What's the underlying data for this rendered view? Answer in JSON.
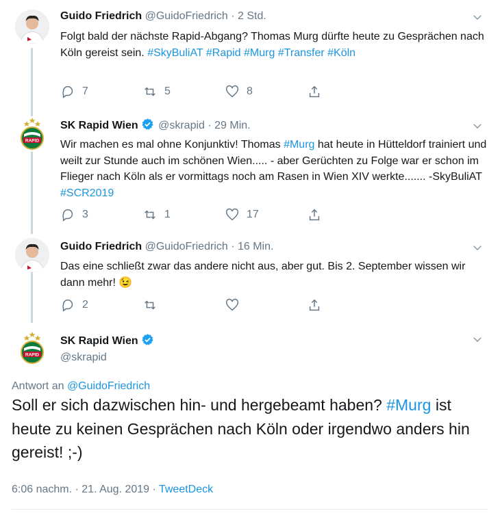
{
  "tweets": [
    {
      "name": "Guido Friedrich",
      "handle": "@GuidoFriedrich",
      "time": "· 2 Std.",
      "text_parts": [
        {
          "t": "Folgt bald der nächste Rapid-Abgang? Thomas Murg dürfte heute zu Gesprächen nach Köln gereist sein. "
        },
        {
          "t": "#SkyBuliAT",
          "tag": true
        },
        {
          "t": " "
        },
        {
          "t": "#Rapid",
          "tag": true
        },
        {
          "t": " "
        },
        {
          "t": "#Murg",
          "tag": true
        },
        {
          "t": " "
        },
        {
          "t": "#Transfer",
          "tag": true
        },
        {
          "t": " "
        },
        {
          "t": "#Köln",
          "tag": true
        }
      ],
      "replies": "7",
      "retweets": "5",
      "likes": "8"
    },
    {
      "name": "SK Rapid Wien",
      "handle": "@skrapid",
      "time": "· 29 Min.",
      "text_parts": [
        {
          "t": "Wir machen es mal ohne Konjunktiv! Thomas "
        },
        {
          "t": "#Murg",
          "tag": true
        },
        {
          "t": " hat heute in Hütteldorf trainiert und weilt zur Stunde auch im schönen Wien..... - aber Gerüchten zu Folge war er schon im Flieger nach Köln als er  vormittags noch am Rasen in Wien XIV werkte....... -SkyBuliAT "
        },
        {
          "t": "#SCR2019",
          "tag": true
        }
      ],
      "replies": "3",
      "retweets": "1",
      "likes": "17"
    },
    {
      "name": "Guido Friedrich",
      "handle": "@GuidoFriedrich",
      "time": "· 16 Min.",
      "text_parts": [
        {
          "t": "Das eine schließt zwar das andere nicht aus, aber gut. Bis 2. September wissen wir dann mehr! "
        },
        {
          "t": "😉"
        }
      ],
      "replies": "2",
      "retweets": "",
      "likes": ""
    }
  ],
  "main": {
    "name": "SK Rapid Wien",
    "handle": "@skrapid",
    "reply_label": "Antwort an ",
    "reply_to": "@GuidoFriedrich",
    "text_parts": [
      {
        "t": "Soll er sich dazwischen hin- und hergebeamt haben? "
      },
      {
        "t": "#Murg",
        "tag": true
      },
      {
        "t": " ist heute zu keinen Gesprächen nach Köln oder irgendwo anders hin gereist! ;-)"
      }
    ],
    "timestamp": "6:06 nachm. · 21. Aug. 2019 · ",
    "source": "TweetDeck"
  },
  "colors": {
    "accent": "#1b95e0",
    "muted": "#657786",
    "text": "#14171a",
    "thread": "#cdd6dd",
    "rapid_green": "#0b7a3b"
  }
}
